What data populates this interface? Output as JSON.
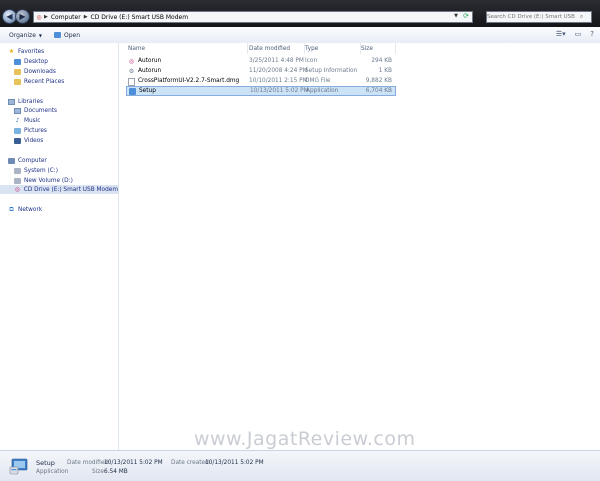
{
  "address": {
    "crumbs": [
      "Computer",
      "CD Drive (E:) Smart USB Modem"
    ]
  },
  "search": {
    "placeholder": "Search CD Drive (E:) Smart USB Modem"
  },
  "toolbar": {
    "organize_label": "Organize",
    "open_label": "Open"
  },
  "navpane": {
    "favorites_label": "Favorites",
    "favorites": [
      "Desktop",
      "Downloads",
      "Recent Places"
    ],
    "libraries_label": "Libraries",
    "libraries": [
      "Documents",
      "Music",
      "Pictures",
      "Videos"
    ],
    "computer_label": "Computer",
    "drives": [
      "System (C:)",
      "New Volume (D:)",
      "CD Drive (E:) Smart USB Modem"
    ],
    "network_label": "Network"
  },
  "columns": [
    "Name",
    "Date modified",
    "Type",
    "Size"
  ],
  "files": [
    {
      "name": "Autorun",
      "date": "3/25/2011 4:48 PM",
      "type": "Icon",
      "size": "294 KB",
      "icon": "icon-file-icon"
    },
    {
      "name": "Autorun",
      "date": "11/20/2008 4:24 PM",
      "type": "Setup Information",
      "size": "1 KB",
      "icon": "setup-info-icon"
    },
    {
      "name": "CrossPlatformUI-V2.2.7-Smart.dmg",
      "date": "10/10/2011 2:15 PM",
      "type": "DMG File",
      "size": "9,882 KB",
      "icon": "generic-file-icon"
    },
    {
      "name": "Setup",
      "date": "10/13/2011 5:02 PM",
      "type": "Application",
      "size": "6,704 KB",
      "icon": "setup-app-icon",
      "selected": true
    }
  ],
  "details": {
    "name": "Setup",
    "type": "Application",
    "modified_label": "Date modified:",
    "modified_value": "10/13/2011 5:02 PM",
    "size_label": "Size:",
    "size_value": "6.54 MB",
    "created_label": "Date created:",
    "created_value": "10/13/2011 5:02 PM"
  },
  "watermark": "www.JagatReview.com",
  "colors": {
    "selection": "#cce2f7",
    "selection_border": "#84acdd",
    "link_text": "#1e3287"
  }
}
